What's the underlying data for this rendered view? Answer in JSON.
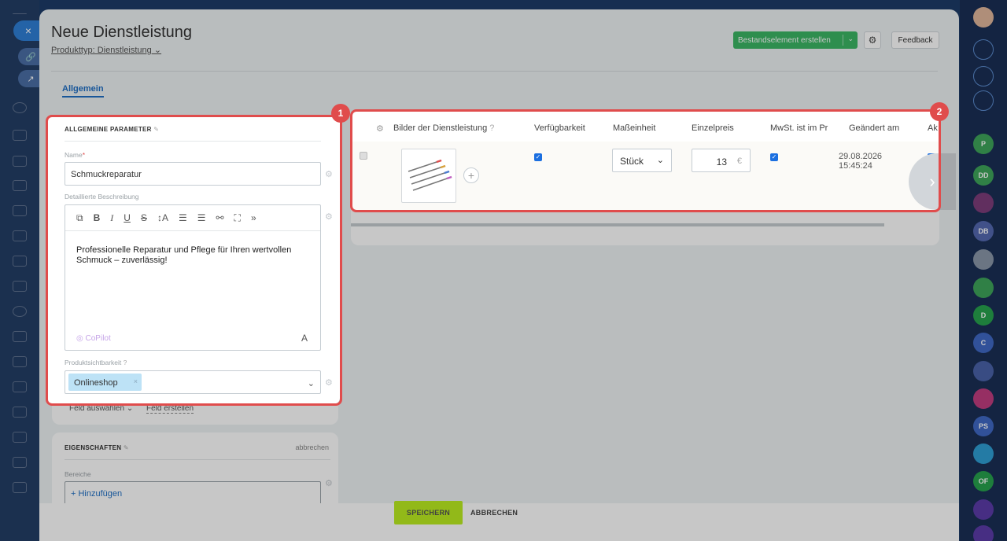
{
  "header": {
    "title": "Neue Dienstleistung",
    "product_type": "Produkttyp: Dienstleistung",
    "create_button": "Bestandselement erstellen",
    "feedback": "Feedback"
  },
  "left_nav": {
    "close_label": "×",
    "link_label": "🔗",
    "open_label": "↗"
  },
  "tabs": [
    "Allgemein"
  ],
  "general": {
    "section_title": "ALLGEMEINE PARAMETER",
    "name_label": "Name",
    "required_mark": "*",
    "name_value": "Schmuckreparatur",
    "description_label": "Detaillierte Beschreibung",
    "description_text": "Professionelle Reparatur und Pflege für Ihren wertvollen Schmuck – zuverlässig!",
    "copilot_label": "CoPilot",
    "visibility_label": "Produktsichtbarkeit",
    "visibility_tag": "Onlineshop",
    "select_field": "Feld auswählen",
    "create_field": "Feld erstellen"
  },
  "properties": {
    "section_title": "EIGENSCHAFTEN",
    "cancel": "abbrechen",
    "areas_label": "Bereiche",
    "add_button": "+ Hinzufügen"
  },
  "grid": {
    "headers": [
      "Bilder der Dienstleistung",
      "Verfügbarkeit",
      "Maßeinheit",
      "Einzelpreis",
      "MwSt. ist im Pr",
      "Geändert am",
      "Ak"
    ],
    "unit": "Stück",
    "price": "13",
    "currency": "€",
    "changed_date": "29.08.2026",
    "changed_time": "15:45:24"
  },
  "badges": [
    "1",
    "2"
  ],
  "footer": {
    "save": "SPEICHERN",
    "cancel": "ABBRECHEN"
  },
  "right_sidebar": [
    "P",
    "DD",
    "DB",
    "D",
    "C",
    "PS",
    "OF"
  ],
  "colors": {
    "accent_green": "#3bb665",
    "save_green": "#bbed21",
    "highlight_red": "#e04c4c",
    "link_blue": "#1f6fc4"
  }
}
